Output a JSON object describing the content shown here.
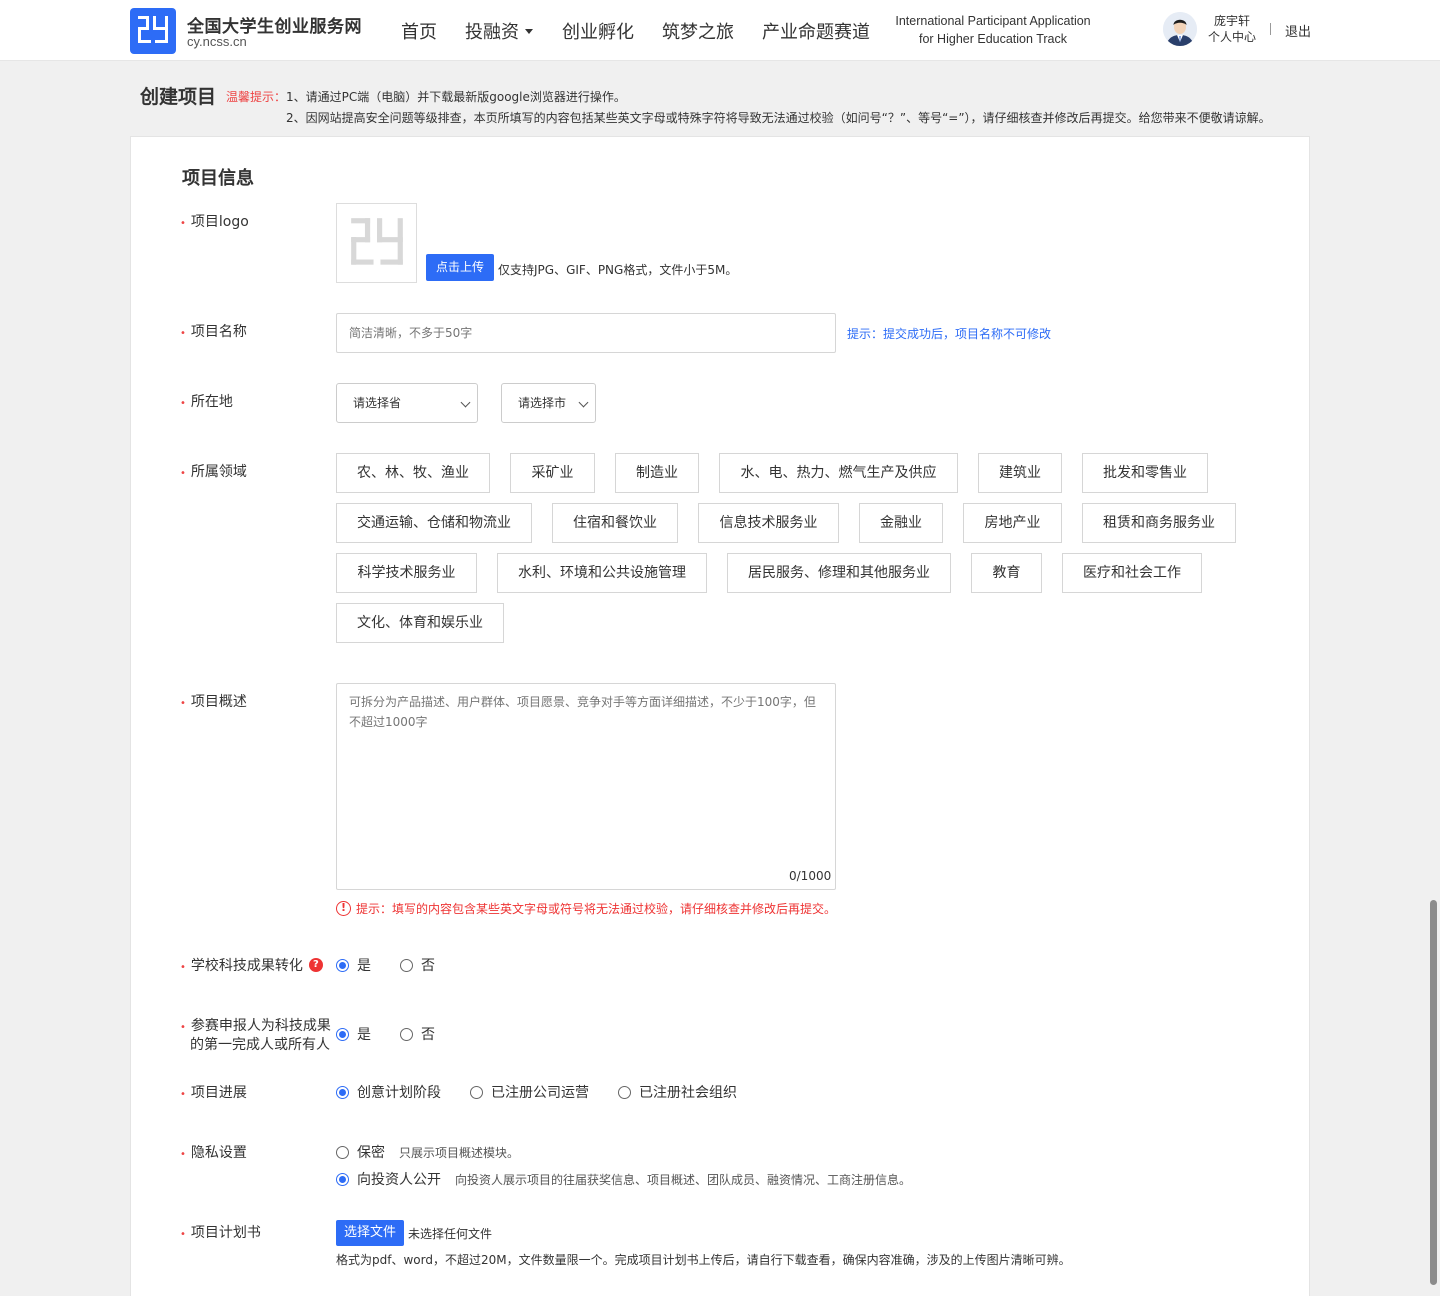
{
  "header": {
    "brand_title": "全国大学生创业服务网",
    "brand_url": "cy.ncss.cn",
    "nav": [
      {
        "label": "首页"
      },
      {
        "label": "投融资"
      },
      {
        "label": "创业孵化"
      },
      {
        "label": "筑梦之旅"
      },
      {
        "label": "产业命题赛道"
      }
    ],
    "intl_line1": "International Participant Application",
    "intl_line2": "for Higher Education Track",
    "user_name": "庞宇轩",
    "user_center": "个人中心",
    "logout": "退出"
  },
  "page": {
    "title": "创建项目",
    "tip_label": "温馨提示：",
    "tip1": "1、请通过PC端（电脑）并下载最新版google浏览器进行操作。",
    "tip2": "2、因网站提高安全问题等级排查，本页所填写的内容包括某些英文字母或特殊字符将导致无法通过校验（如问号“？”、等号“=”），请仔细核查并修改后再提交。给您带来不便敬请谅解。"
  },
  "form": {
    "section_title": "项目信息",
    "logo": {
      "label": "项目logo",
      "upload_button": "点击上传",
      "note": "仅支持JPG、GIF、PNG格式，文件小于5M。"
    },
    "name": {
      "label": "项目名称",
      "placeholder": "简洁清晰，不多于50字",
      "hint": "提示：提交成功后，项目名称不可修改"
    },
    "location": {
      "label": "所在地",
      "province": "请选择省",
      "city": "请选择市"
    },
    "domain": {
      "label": "所属领域",
      "tags": [
        "农、林、牧、渔业",
        "采矿业",
        "制造业",
        "水、电、热力、燃气生产及供应",
        "建筑业",
        "批发和零售业",
        "交通运输、仓储和物流业",
        "住宿和餐饮业",
        "信息技术服务业",
        "金融业",
        "房地产业",
        "租赁和商务服务业",
        "科学技术服务业",
        "水利、环境和公共设施管理",
        "居民服务、修理和其他服务业",
        "教育",
        "医疗和社会工作",
        "文化、体育和娱乐业"
      ]
    },
    "overview": {
      "label": "项目概述",
      "placeholder": "可拆分为产品描述、用户群体、项目愿景、竞争对手等方面详细描述，不少于100字，但不超过1000字",
      "counter": "0/1000",
      "warning": "提示：填写的内容包含某些英文字母或符号将无法通过校验，请仔细核查并修改后再提交。"
    },
    "tech_transfer": {
      "label": "学校科技成果转化",
      "help": "?",
      "yes": "是",
      "no": "否",
      "selected": "yes"
    },
    "first_finisher": {
      "label_line1": "参赛申报人为科技成果",
      "label_line2": "的第一完成人或所有人",
      "yes": "是",
      "no": "否",
      "selected": "yes"
    },
    "progress": {
      "label": "项目进展",
      "options": [
        "创意计划阶段",
        "已注册公司运营",
        "已注册社会组织"
      ],
      "selected": "创意计划阶段"
    },
    "privacy": {
      "label": "隐私设置",
      "secret": "保密",
      "secret_desc": "只展示项目概述模块。",
      "public": "向投资人公开",
      "public_desc": "向投资人展示项目的往届获奖信息、项目概述、团队成员、融资情况、工商注册信息。",
      "selected": "public"
    },
    "plan": {
      "label": "项目计划书",
      "button": "选择文件",
      "status": "未选择任何文件",
      "note": "格式为pdf、word，不超过20M，文件数量限一个。完成项目计划书上传后，请自行下载查看，确保内容准确，涉及的上传图片清晰可辨。"
    }
  },
  "colors": {
    "primary": "#2d6cf6",
    "danger": "#e44444",
    "background": "#f0f0f0"
  }
}
